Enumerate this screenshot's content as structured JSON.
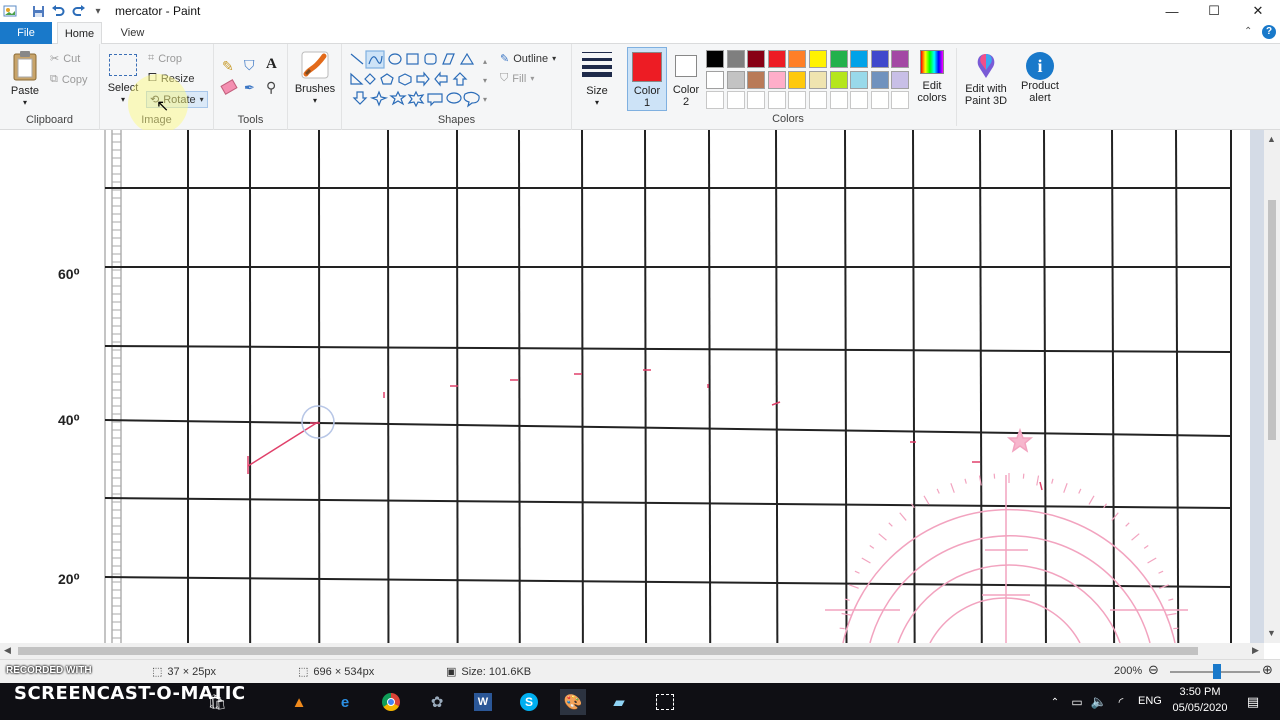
{
  "window": {
    "title": "mercator - Paint",
    "controls": {
      "minimize": "—",
      "maximize": "☐",
      "close": "✕"
    }
  },
  "tabs": [
    "File",
    "Home",
    "View"
  ],
  "ribbon": {
    "clipboard": {
      "label": "Clipboard",
      "paste": "Paste",
      "cut": "Cut",
      "copy": "Copy"
    },
    "image": {
      "label": "Image",
      "select": "Select",
      "crop": "Crop",
      "resize": "Resize",
      "rotate": "Rotate"
    },
    "tools": {
      "label": "Tools"
    },
    "brushes": {
      "label": "Brushes"
    },
    "shapes": {
      "label": "Shapes",
      "outline": "Outline",
      "fill": "Fill"
    },
    "size": {
      "label": "Size"
    },
    "color1": {
      "label_line1": "Color",
      "label_line2": "1",
      "color": "#ed1c24"
    },
    "color2": {
      "label_line1": "Color",
      "label_line2": "2",
      "color": "#ffffff"
    },
    "colors": {
      "label": "Colors",
      "edit": "Edit colors"
    },
    "paint3d": {
      "label_line1": "Edit with",
      "label_line2": "Paint 3D"
    },
    "alert": {
      "label_line1": "Product",
      "label_line2": "alert"
    },
    "palette_row1": [
      "#000000",
      "#7f7f7f",
      "#880015",
      "#ed1c24",
      "#ff7f27",
      "#fff200",
      "#22b14c",
      "#00a2e8",
      "#3f48cc",
      "#a349a4"
    ],
    "palette_row2": [
      "#ffffff",
      "#c3c3c3",
      "#b97a57",
      "#ffaec9",
      "#ffc90e",
      "#efe4b0",
      "#b5e61d",
      "#99d9ea",
      "#7092be",
      "#c8bfe7"
    ]
  },
  "canvas": {
    "latitude_labels": [
      "60⁰",
      "40⁰",
      "20⁰"
    ]
  },
  "statusbar": {
    "selection_size": "37 × 25px",
    "image_size": "696 × 534px",
    "file_size": "Size: 101.6KB",
    "zoom": "200%"
  },
  "watermark": {
    "recorded": "RECORDED WITH",
    "brand": "SCREENCAST-O-MATIC"
  },
  "taskbar": {
    "language": "ENG",
    "time": "3:50 PM",
    "date": "05/05/2020"
  }
}
